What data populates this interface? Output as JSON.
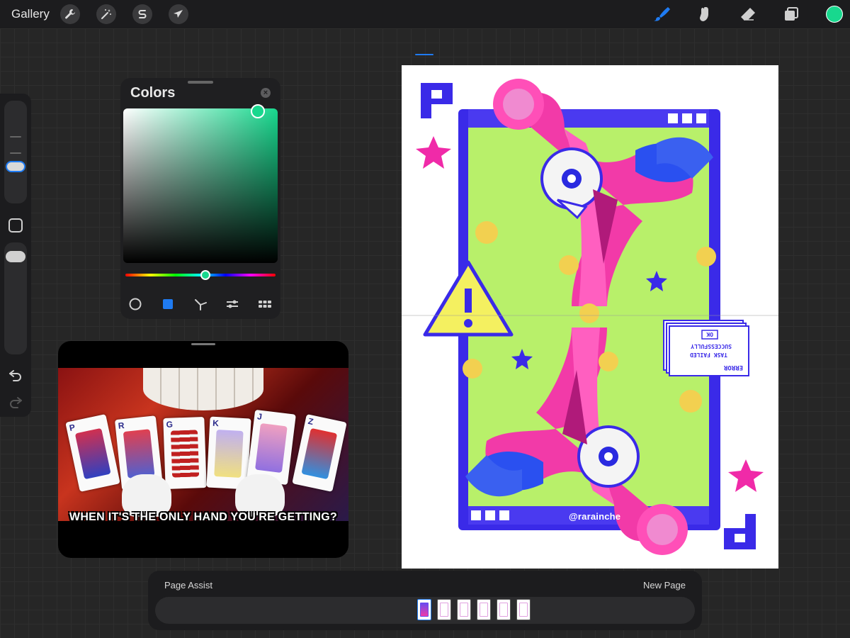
{
  "topbar": {
    "gallery_label": "Gallery",
    "left_tools": [
      "wrench-icon",
      "magic-wand-icon",
      "selection-s-icon",
      "transform-arrow-icon"
    ],
    "right_tools": [
      "brush-icon",
      "smudge-icon",
      "eraser-icon",
      "layers-icon"
    ],
    "current_color": "#18d88e",
    "active_tool_color": "#1f7bf2"
  },
  "colors_panel": {
    "title": "Colors",
    "close_icon": "close-icon",
    "hue_color": "#18d88e",
    "modes": [
      "disc-icon",
      "classic-square-icon",
      "harmony-icon",
      "value-sliders-icon",
      "palettes-grid-icon"
    ]
  },
  "reference": {
    "caption": "WHEN IT'S THE ONLY HAND YOU'RE GETTING?",
    "cards": [
      "P",
      "R",
      "G",
      "K",
      "J",
      "Z"
    ]
  },
  "canvas": {
    "watermark": "@rarainche",
    "dialog_lines": [
      "ERROR",
      "TASK FAILED",
      "SUCCESSFULLY",
      "OK"
    ],
    "corner_letter": "P"
  },
  "page_assist": {
    "title": "Page Assist",
    "new_page_label": "New Page",
    "page_count": 6,
    "active_page": 1
  }
}
